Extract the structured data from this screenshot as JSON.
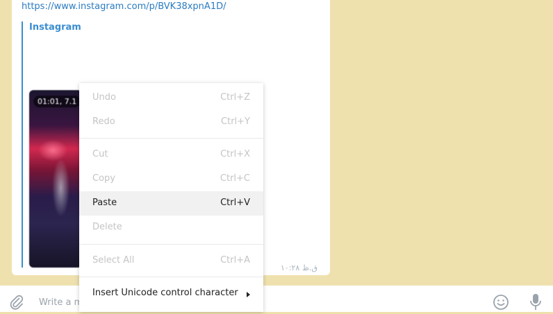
{
  "message": {
    "link": "https://www.instagram.com/p/BVK38xpnA1D/",
    "site_name": "Instagram",
    "video_badge": "01:01, 7.1",
    "timestamp": "۱۰:۲۸ ق.ظ"
  },
  "composer": {
    "placeholder": "Write a m"
  },
  "context_menu": {
    "items": [
      {
        "label": "Undo",
        "shortcut": "Ctrl+Z"
      },
      {
        "label": "Redo",
        "shortcut": "Ctrl+Y"
      },
      {
        "label": "Cut",
        "shortcut": "Ctrl+X"
      },
      {
        "label": "Copy",
        "shortcut": "Ctrl+C"
      },
      {
        "label": "Paste",
        "shortcut": "Ctrl+V"
      },
      {
        "label": "Delete",
        "shortcut": ""
      },
      {
        "label": "Select All",
        "shortcut": "Ctrl+A"
      },
      {
        "label": "Insert Unicode control character",
        "shortcut": ""
      }
    ]
  },
  "colors": {
    "background": "#efe1ae",
    "link": "#2b7bc1",
    "accent": "#3a8dd1"
  },
  "icons": {
    "attach": "paperclip-icon",
    "emoji": "emoji-icon",
    "mic": "microphone-icon",
    "submenu": "submenu-arrow-icon"
  }
}
